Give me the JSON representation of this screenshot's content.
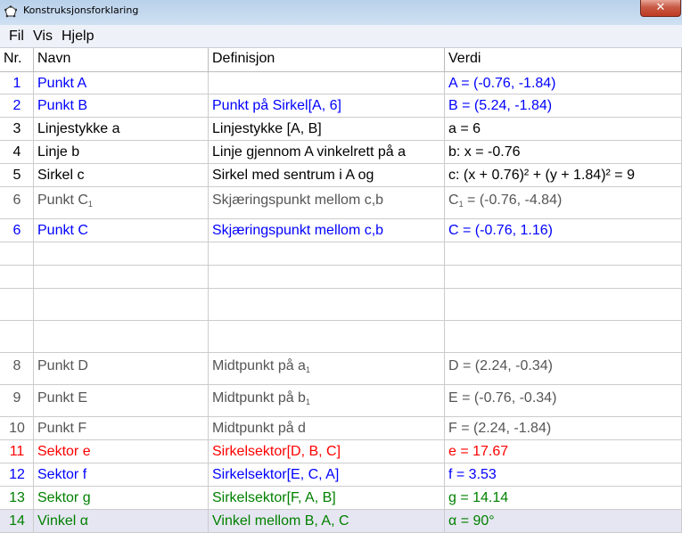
{
  "window": {
    "title": "Konstruksjonsforklaring",
    "close_label": "✕"
  },
  "menu": [
    "Fil",
    "Vis",
    "Hjelp"
  ],
  "columns": [
    "Nr.",
    "Navn",
    "Definisjon",
    "Verdi"
  ],
  "colors": {
    "blue": "#0000ff",
    "black": "#000000",
    "gray": "#555555",
    "red": "#ff0000",
    "green": "#008000",
    "highlight": "#e6e6f2"
  },
  "rows": [
    {
      "nr": "1",
      "name": "Punkt A",
      "definition": "",
      "value": "A = (-0.76, -1.84)",
      "color": "blue"
    },
    {
      "nr": "2",
      "name": "Punkt B",
      "definition": "Punkt på Sirkel[A, 6]",
      "value": "B = (5.24, -1.84)",
      "color": "blue"
    },
    {
      "nr": "3",
      "name": "Linjestykke a",
      "definition": "Linjestykke [A, B]",
      "value": "a = 6",
      "color": "black"
    },
    {
      "nr": "4",
      "name": "Linje b",
      "definition": "Linje gjennom A vinkelrett på a",
      "value": "b: x = -0.76",
      "color": "black"
    },
    {
      "nr": "5",
      "name": "Sirkel c",
      "definition": "Sirkel med sentrum i A og",
      "value": "c: (x + 0.76)² + (y + 1.84)² = 9",
      "color": "black"
    },
    {
      "nr": "6",
      "name": "Punkt C",
      "name_sub": "1",
      "definition": "Skjæringspunkt mellom c,b",
      "value": "C",
      "value_sub": "1",
      "value_rest": " = (-0.76, -4.84)",
      "color": "gray"
    },
    {
      "nr": "6",
      "name": "Punkt C",
      "definition": "Skjæringspunkt mellom c,b",
      "value": "C = (-0.76, 1.16)",
      "color": "blue"
    },
    {
      "nr": "",
      "name": "",
      "definition": "",
      "value": "",
      "color": "black"
    },
    {
      "nr": "",
      "name": "",
      "definition": "",
      "value": "",
      "color": "black"
    },
    {
      "nr": "",
      "name": "",
      "definition": "",
      "value": "",
      "color": "black"
    },
    {
      "nr": "",
      "name": "",
      "definition": "",
      "value": "",
      "color": "black"
    },
    {
      "nr": "8",
      "name": "Punkt D",
      "definition": "Midtpunkt på a",
      "def_sub": "1",
      "value": "D = (2.24, -0.34)",
      "color": "gray"
    },
    {
      "nr": "9",
      "name": "Punkt E",
      "definition": "Midtpunkt på b",
      "def_sub": "1",
      "value": "E = (-0.76, -0.34)",
      "color": "gray"
    },
    {
      "nr": "10",
      "name": "Punkt F",
      "definition": "Midtpunkt på d",
      "value": "F = (2.24, -1.84)",
      "color": "gray"
    },
    {
      "nr": "11",
      "name": "Sektor e",
      "definition": "Sirkelsektor[D, B, C]",
      "value": "e = 17.67",
      "color": "red"
    },
    {
      "nr": "12",
      "name": "Sektor f",
      "definition": "Sirkelsektor[E, C, A]",
      "value": "f = 3.53",
      "color": "blue"
    },
    {
      "nr": "13",
      "name": "Sektor g",
      "definition": "Sirkelsektor[F, A, B]",
      "value": "g = 14.14",
      "color": "green"
    },
    {
      "nr": "14",
      "name": "Vinkel α",
      "definition": "Vinkel mellom B, A, C",
      "value": "α = 90°",
      "color": "green",
      "selected": true
    }
  ]
}
